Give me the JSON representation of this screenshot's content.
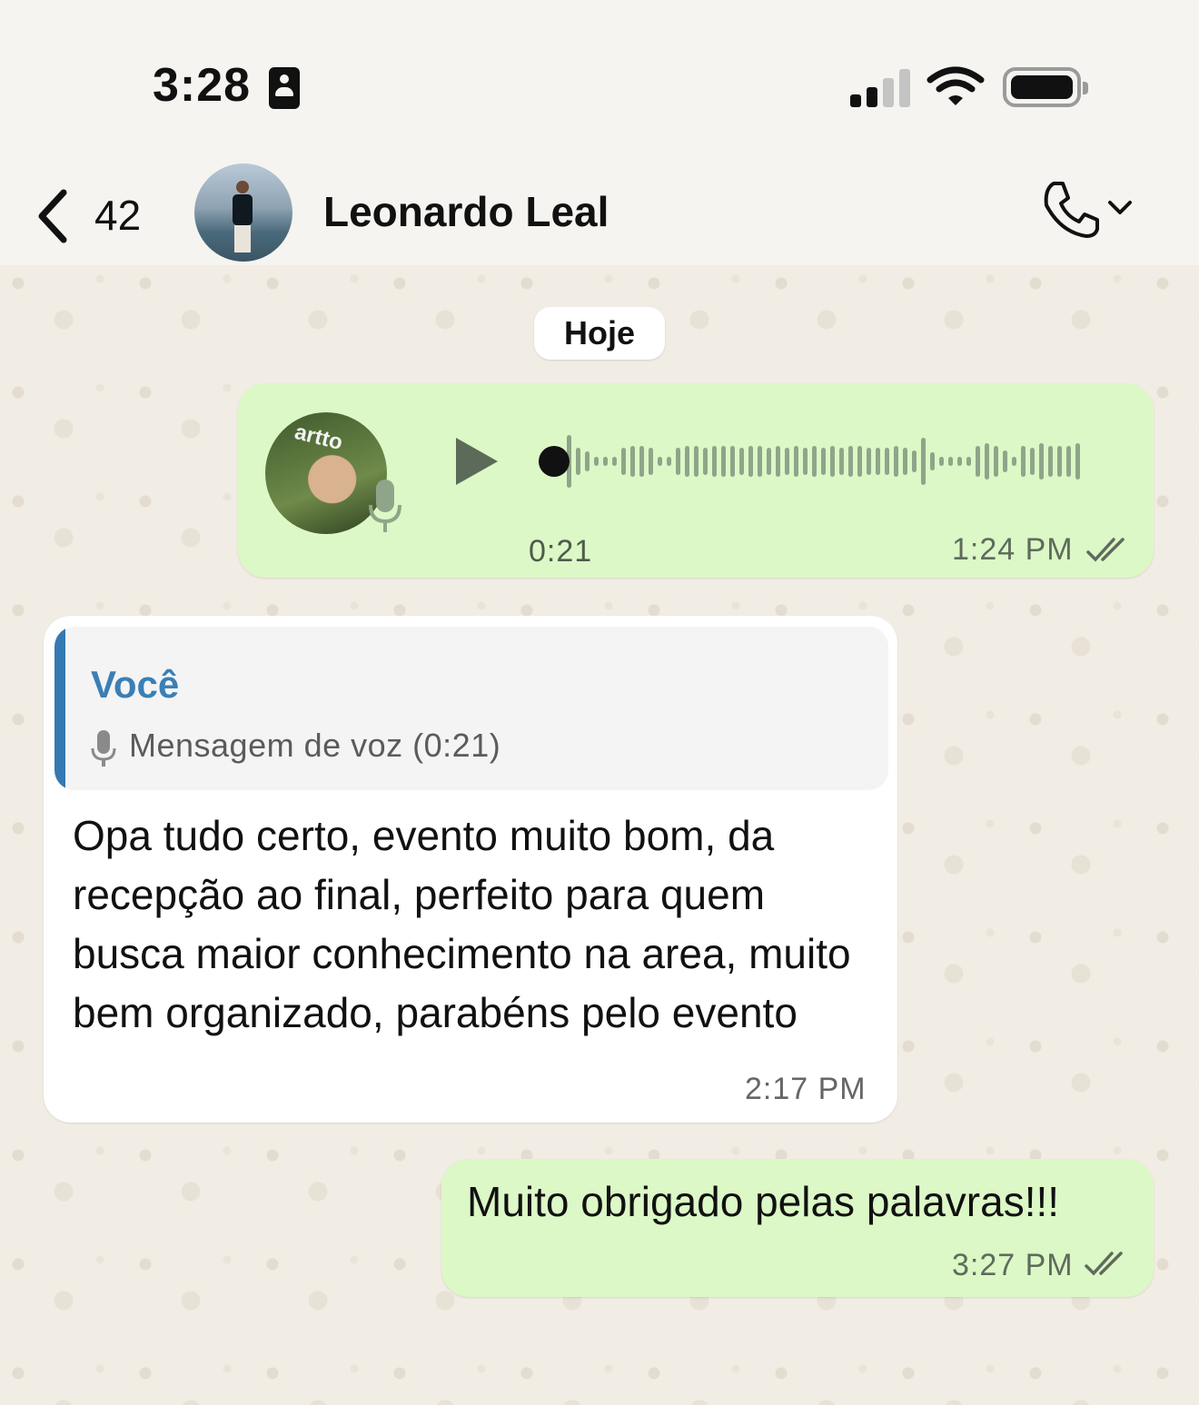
{
  "status_bar": {
    "time": "3:28"
  },
  "header": {
    "back_count": "42",
    "contact_name": "Leonardo Leal"
  },
  "chat": {
    "date_chip": "Hoje",
    "voice_message": {
      "duration": "0:21",
      "time": "1:24 PM",
      "avatar_text": "artto"
    },
    "reply_message": {
      "quote_author": "Você",
      "quote_text": "Mensagem de voz (0:21)",
      "text": "Opa tudo certo, evento muito bom, da recepção ao final, perfeito para quem busca maior conhecimento na area, muito bem organizado, parabéns pelo evento",
      "time": "2:17 PM"
    },
    "outgoing_message": {
      "text": "Muito obrigado pelas palavras!!!",
      "time": "3:27 PM"
    }
  },
  "colors": {
    "outgoing_bubble": "#dcf8c6",
    "incoming_bubble": "#ffffff",
    "quote_accent": "#3579b2",
    "waveform": "#8fa58a"
  }
}
